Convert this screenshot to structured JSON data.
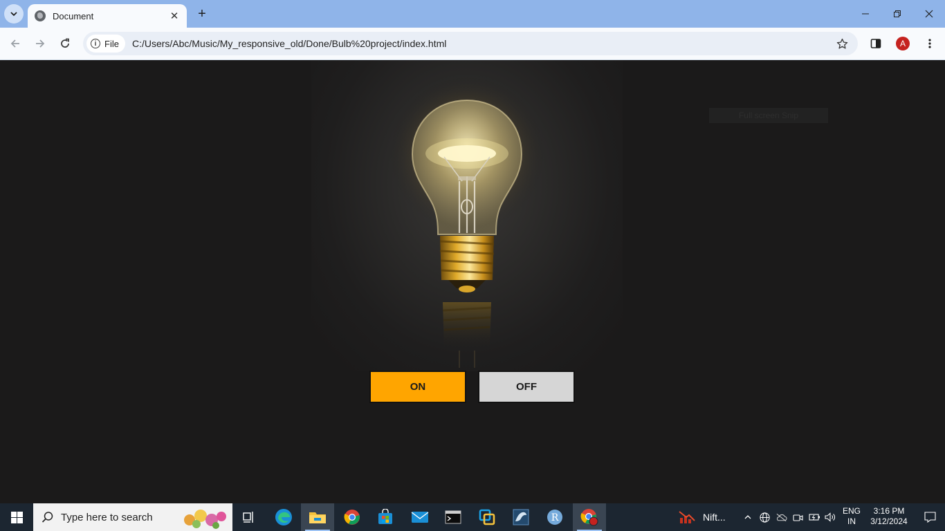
{
  "browser": {
    "tab_title": "Document",
    "url_chip": "File",
    "url": "C:/Users/Abc/Music/My_responsive_old/Done/Bulb%20project/index.html",
    "profile_initial": "A"
  },
  "page": {
    "fullscreen_tip": "Full screen Snip",
    "on_label": "ON",
    "off_label": "OFF",
    "bulb_state": "on"
  },
  "taskbar": {
    "search_placeholder": "Type here to search",
    "pinned": [
      "task-view-icon",
      "edge-icon",
      "file-explorer-icon",
      "chrome-icon",
      "store-icon",
      "mail-icon",
      "terminal-icon",
      "sticky-app-icon",
      "mysql-icon",
      "r-icon",
      "chrome-profile-icon"
    ],
    "stock_widget": "Nift...",
    "language_top": "ENG",
    "language_bottom": "IN",
    "time": "3:16 PM",
    "date": "3/12/2024"
  },
  "colors": {
    "on_button": "#ffa500",
    "off_button": "#d6d6d6",
    "page_bg": "#1b1a1a",
    "tab_strip": "#8fb4e9"
  }
}
